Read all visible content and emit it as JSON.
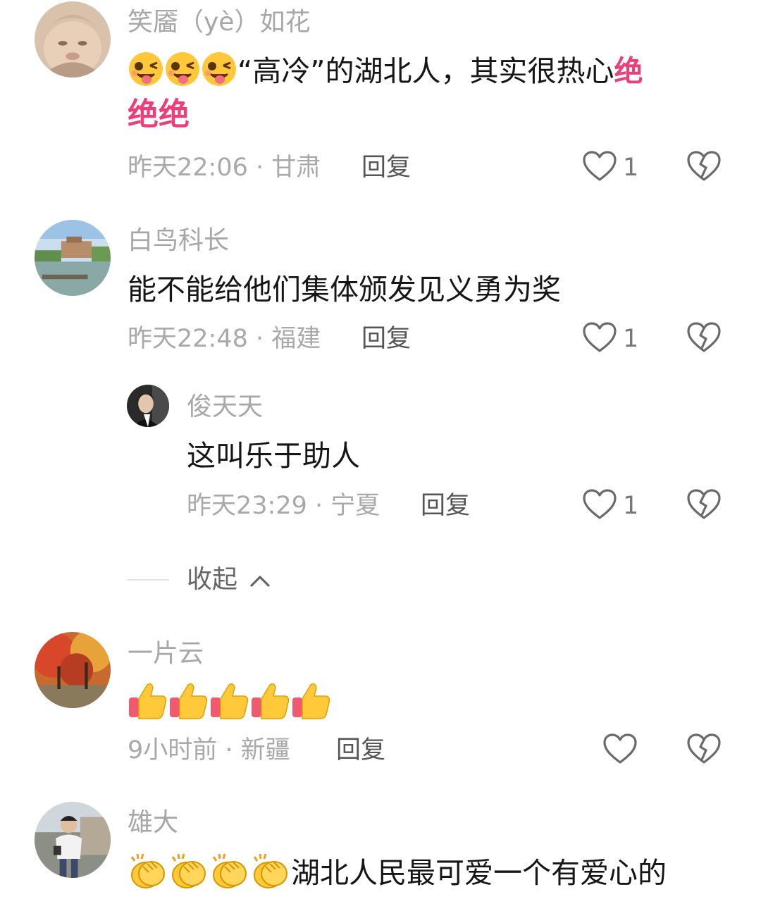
{
  "colors": {
    "accent": "#ee3e7a",
    "meta": "#a9a9a9",
    "name": "#a7a7a7",
    "text": "#161616"
  },
  "comments": [
    {
      "user": "笑靥（yè）如花",
      "text": "“高冷”的湖北人，其实很热心",
      "accent_text_1": "绝",
      "accent_text_2": "绝绝",
      "emoji_prefix": "tongue-wink-emoji x3",
      "meta": "昨天22:06 · 甘肃",
      "reply": "回复",
      "likes": "1"
    },
    {
      "user": "白鸟科长",
      "text": "能不能给他们集体颁发见义勇为奖",
      "meta": "昨天22:48 · 福建",
      "reply": "回复",
      "likes": "1",
      "reply_item": {
        "user": "俊天天",
        "text": "这叫乐于助人",
        "meta": "昨天23:29 · 宁夏",
        "reply": "回复",
        "likes": "1"
      },
      "collapse_label": "收起"
    },
    {
      "user": "一片云",
      "emoji_only": "thumbs-up-emoji x5",
      "meta": "9小时前 · 新疆",
      "reply": "回复",
      "likes": ""
    },
    {
      "user": "雄大",
      "text": "湖北人民最可爱一个有爱心的",
      "emoji_prefix": "clapping-emoji x4"
    }
  ],
  "icons": {
    "like": "heart-outline-icon",
    "dislike": "broken-heart-icon",
    "collapse": "chevron-up-icon"
  }
}
